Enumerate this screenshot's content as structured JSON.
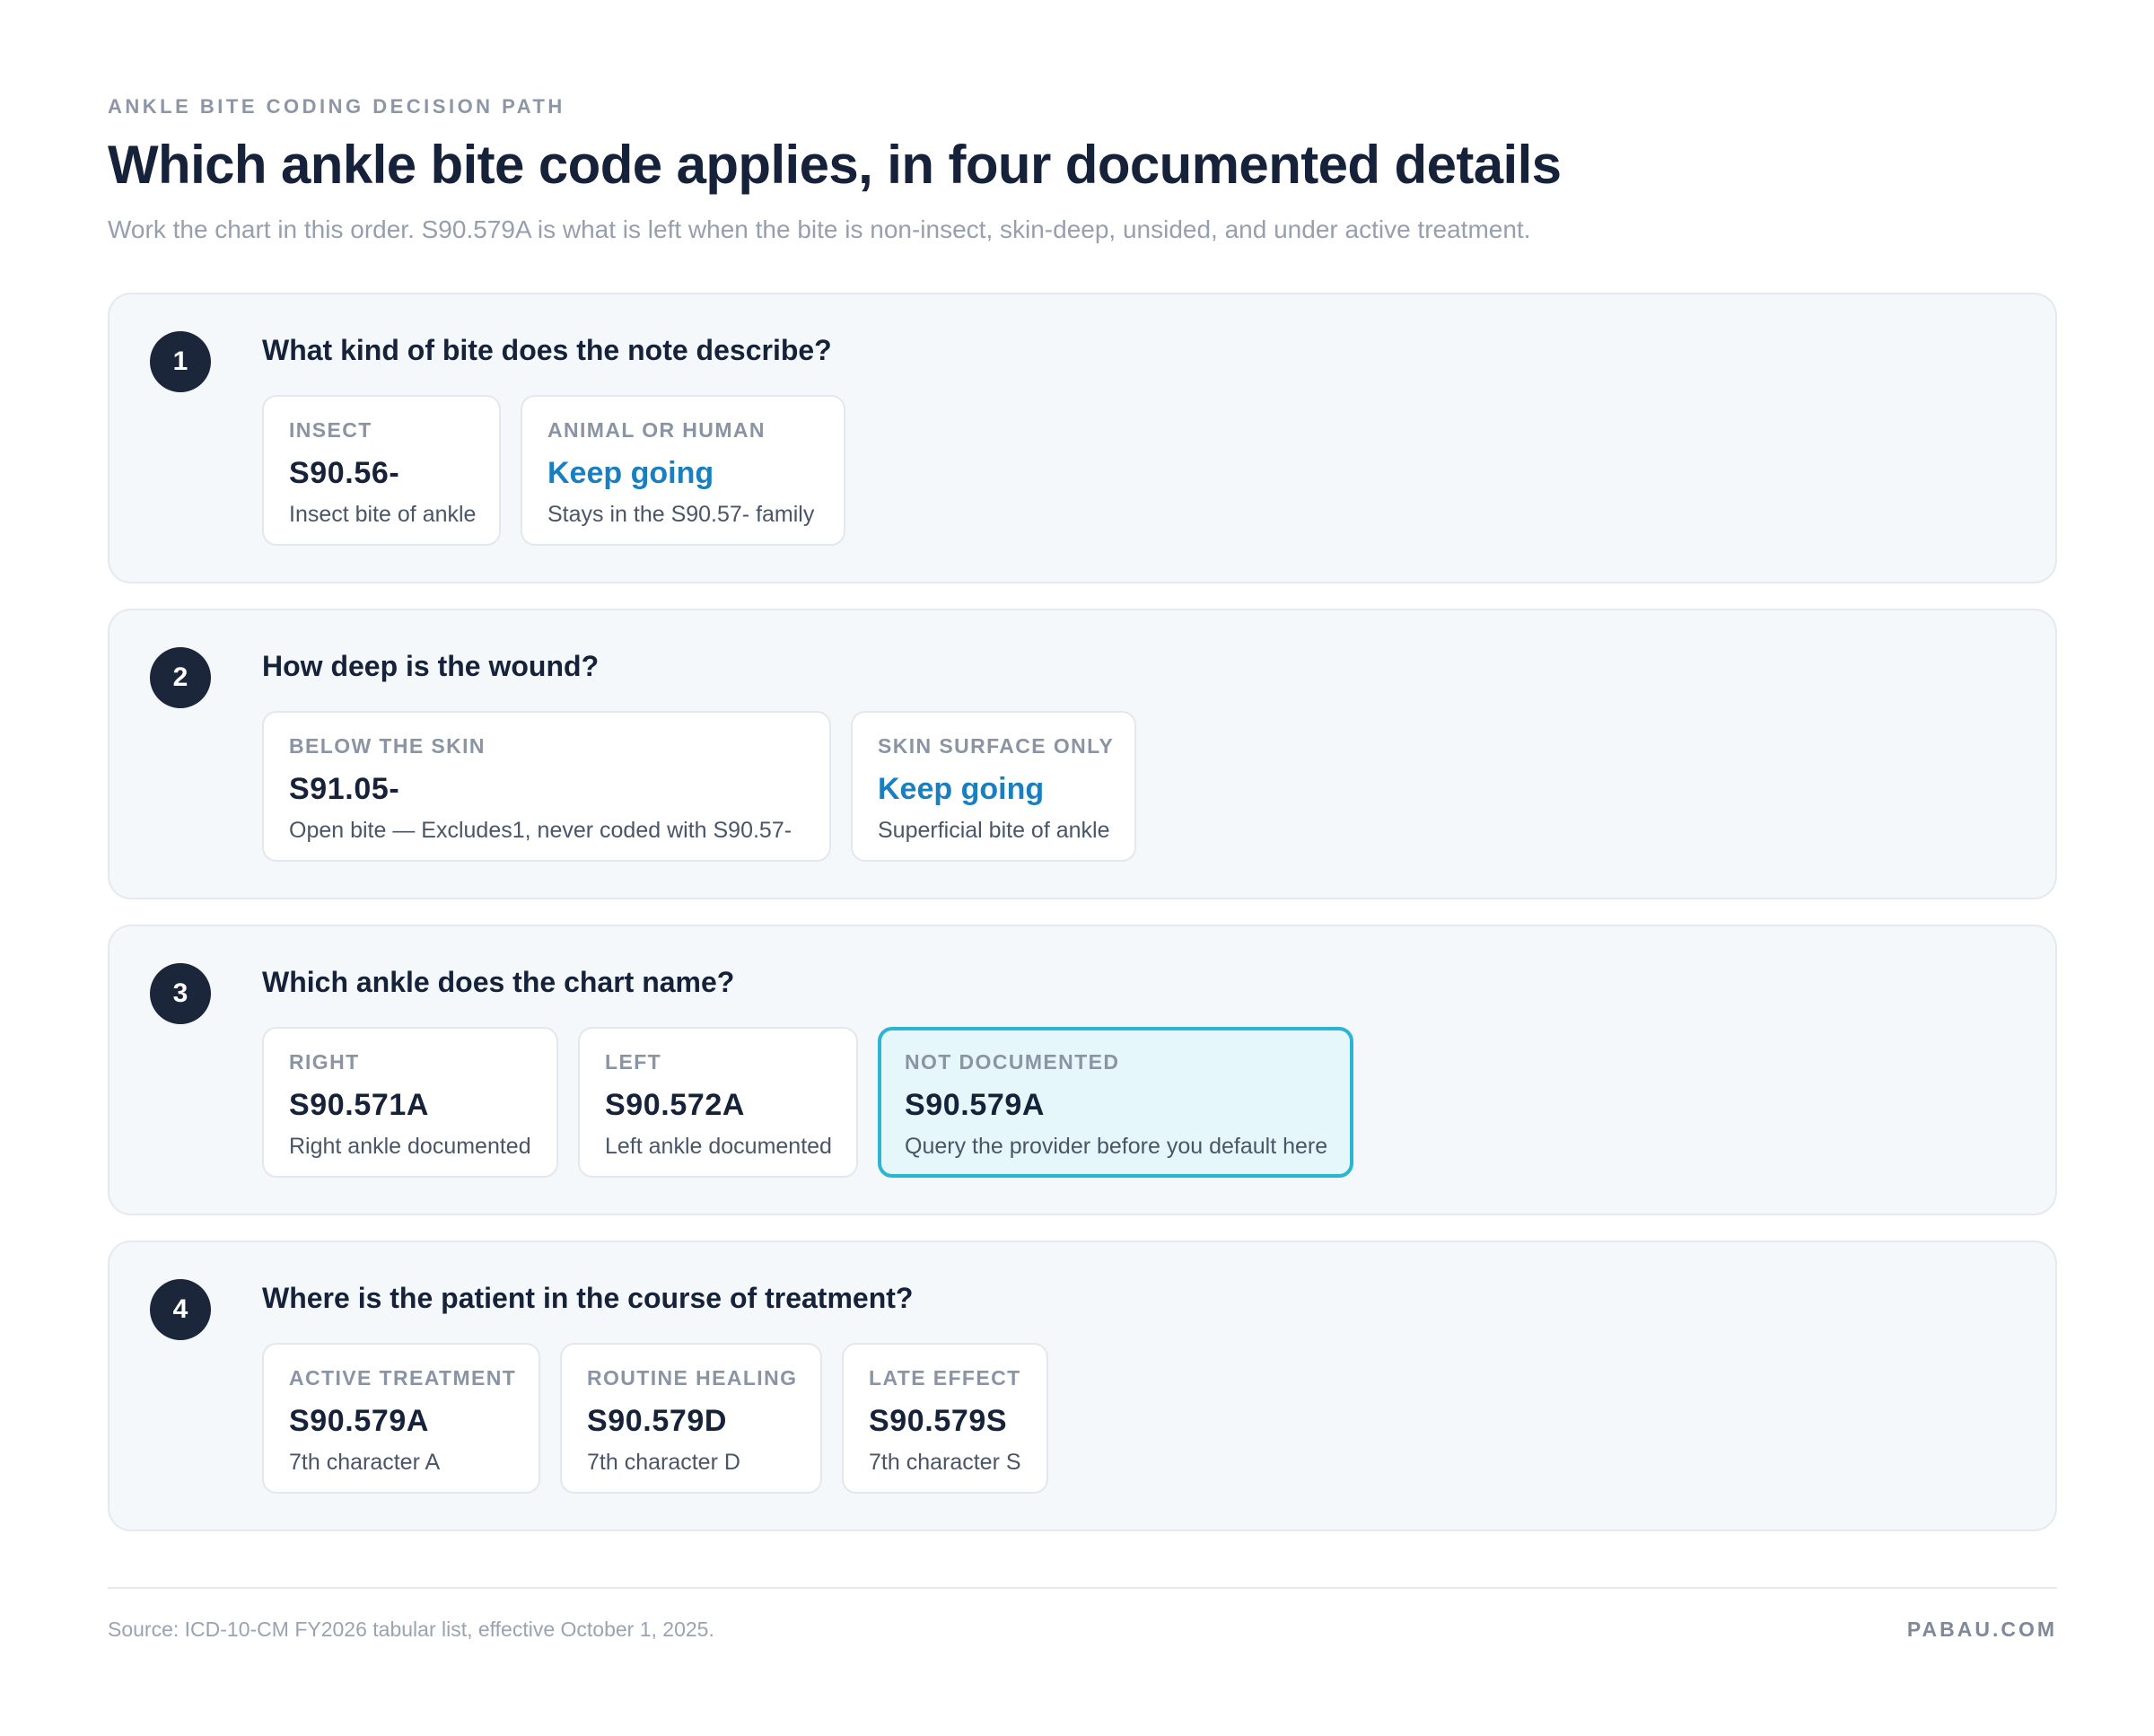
{
  "header": {
    "eyebrow": "ANKLE BITE CODING DECISION PATH",
    "title": "Which ankle bite code applies, in four documented details",
    "subtitle": "Work the chart in this order. S90.579A is what is left when the bite is non-insect, skin-deep, unsided, and under active treatment."
  },
  "steps": [
    {
      "number": "1",
      "question": "What kind of bite does the note describe?",
      "options": [
        {
          "label": "INSECT",
          "code": "S90.56-",
          "description": "Insect bite of ankle"
        },
        {
          "label": "ANIMAL OR HUMAN",
          "code": "Keep going",
          "description": "Stays in the S90.57- family"
        }
      ]
    },
    {
      "number": "2",
      "question": "How deep is the wound?",
      "options": [
        {
          "label": "BELOW THE SKIN",
          "code": "S91.05-",
          "description": "Open bite — Excludes1, never coded with S90.57-"
        },
        {
          "label": "SKIN SURFACE ONLY",
          "code": "Keep going",
          "description": "Superficial bite of ankle"
        }
      ]
    },
    {
      "number": "3",
      "question": "Which ankle does the chart name?",
      "options": [
        {
          "label": "RIGHT",
          "code": "S90.571A",
          "description": "Right ankle documented"
        },
        {
          "label": "LEFT",
          "code": "S90.572A",
          "description": "Left ankle documented"
        },
        {
          "label": "NOT DOCUMENTED",
          "code": "S90.579A",
          "description": "Query the provider before you default here"
        }
      ]
    },
    {
      "number": "4",
      "question": "Where is the patient in the course of treatment?",
      "options": [
        {
          "label": "ACTIVE TREATMENT",
          "code": "S90.579A",
          "description": "7th character A"
        },
        {
          "label": "ROUTINE HEALING",
          "code": "S90.579D",
          "description": "7th character D"
        },
        {
          "label": "LATE EFFECT",
          "code": "S90.579S",
          "description": "7th character S"
        }
      ]
    }
  ],
  "footer": {
    "source": "Source: ICD-10-CM FY2026 tabular list, effective October 1, 2025.",
    "brand": "PABAU.COM"
  },
  "colors": {
    "navy": "#1b263b",
    "keep_going": "#1a7fc0",
    "highlight_border": "#2bb5d2",
    "highlight_fill": "#e6f7fb"
  }
}
